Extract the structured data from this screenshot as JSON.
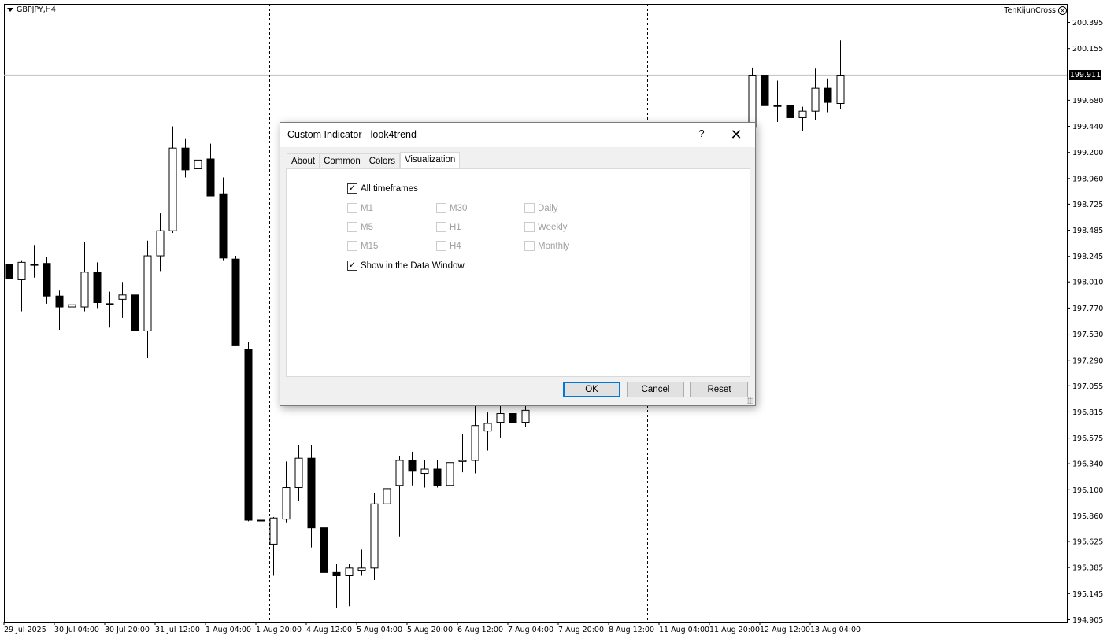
{
  "chart": {
    "symbol": "GBPJPY,H4",
    "indicator": "TenKijunCross",
    "current_price": "199.911",
    "price_levels": [
      "200.395",
      "200.155",
      "199.680",
      "199.440",
      "199.200",
      "198.960",
      "198.725",
      "198.485",
      "198.245",
      "198.010",
      "197.770",
      "197.530",
      "197.290",
      "197.055",
      "196.815",
      "196.575",
      "196.340",
      "196.100",
      "195.860",
      "195.625",
      "195.385",
      "195.145",
      "194.905"
    ],
    "time_labels": [
      "29 Jul 2025",
      "30 Jul 04:00",
      "30 Jul 20:00",
      "31 Jul 12:00",
      "1 Aug 04:00",
      "1 Aug 20:00",
      "4 Aug 12:00",
      "5 Aug 04:00",
      "5 Aug 20:00",
      "6 Aug 12:00",
      "7 Aug 04:00",
      "7 Aug 20:00",
      "8 Aug 12:00",
      "11 Aug 04:00",
      "11 Aug 20:00",
      "12 Aug 12:00",
      "13 Aug 04:00"
    ],
    "colors": {
      "bull_fill": "#ffffff",
      "bear_fill": "#000000",
      "grid": "#000000",
      "bid_line": "#c0c0c0"
    }
  },
  "chart_data": {
    "type": "candlestick",
    "xlabel": "",
    "ylabel": "",
    "ylim": [
      194.905,
      200.395
    ],
    "candles": [
      {
        "o": 198.17,
        "h": 198.29,
        "l": 198.0,
        "c": 198.04
      },
      {
        "o": 198.03,
        "h": 198.21,
        "l": 197.74,
        "c": 198.19
      },
      {
        "o": 198.17,
        "h": 198.35,
        "l": 198.05,
        "c": 198.17
      },
      {
        "o": 198.18,
        "h": 198.24,
        "l": 197.81,
        "c": 197.88
      },
      {
        "o": 197.88,
        "h": 197.93,
        "l": 197.57,
        "c": 197.78
      },
      {
        "o": 197.78,
        "h": 197.82,
        "l": 197.48,
        "c": 197.8
      },
      {
        "o": 197.78,
        "h": 198.38,
        "l": 197.74,
        "c": 198.1
      },
      {
        "o": 198.1,
        "h": 198.19,
        "l": 197.77,
        "c": 197.82
      },
      {
        "o": 197.81,
        "h": 197.92,
        "l": 197.59,
        "c": 197.81
      },
      {
        "o": 197.85,
        "h": 198.01,
        "l": 197.68,
        "c": 197.89
      },
      {
        "o": 197.89,
        "h": 197.9,
        "l": 197.0,
        "c": 197.56
      },
      {
        "o": 197.56,
        "h": 198.39,
        "l": 197.31,
        "c": 198.25
      },
      {
        "o": 198.25,
        "h": 198.64,
        "l": 198.11,
        "c": 198.48
      },
      {
        "o": 198.48,
        "h": 199.44,
        "l": 198.46,
        "c": 199.24
      },
      {
        "o": 199.24,
        "h": 199.33,
        "l": 198.97,
        "c": 199.04
      },
      {
        "o": 199.05,
        "h": 199.14,
        "l": 198.99,
        "c": 199.13
      },
      {
        "o": 199.14,
        "h": 199.28,
        "l": 198.86,
        "c": 198.8
      },
      {
        "o": 198.82,
        "h": 198.97,
        "l": 198.21,
        "c": 198.23
      },
      {
        "o": 198.22,
        "h": 198.25,
        "l": 197.43,
        "c": 197.43
      },
      {
        "o": 197.39,
        "h": 197.46,
        "l": 195.81,
        "c": 195.82
      },
      {
        "o": 195.82,
        "h": 195.84,
        "l": 195.35,
        "c": 195.82
      },
      {
        "o": 195.6,
        "h": 195.85,
        "l": 195.31,
        "c": 195.84
      },
      {
        "o": 195.83,
        "h": 196.36,
        "l": 195.8,
        "c": 196.12
      },
      {
        "o": 196.12,
        "h": 196.51,
        "l": 196.0,
        "c": 196.39
      },
      {
        "o": 196.39,
        "h": 196.51,
        "l": 195.57,
        "c": 195.75
      },
      {
        "o": 195.75,
        "h": 196.11,
        "l": 195.33,
        "c": 195.34
      },
      {
        "o": 195.34,
        "h": 195.42,
        "l": 195.01,
        "c": 195.31
      },
      {
        "o": 195.31,
        "h": 195.42,
        "l": 195.03,
        "c": 195.38
      },
      {
        "o": 195.36,
        "h": 195.55,
        "l": 195.31,
        "c": 195.38
      },
      {
        "o": 195.38,
        "h": 196.07,
        "l": 195.27,
        "c": 195.97
      },
      {
        "o": 195.97,
        "h": 196.4,
        "l": 195.9,
        "c": 196.11
      },
      {
        "o": 196.14,
        "h": 196.41,
        "l": 195.67,
        "c": 196.37
      },
      {
        "o": 196.37,
        "h": 196.45,
        "l": 196.14,
        "c": 196.27
      },
      {
        "o": 196.25,
        "h": 196.37,
        "l": 196.12,
        "c": 196.29
      },
      {
        "o": 196.29,
        "h": 196.37,
        "l": 196.12,
        "c": 196.14
      },
      {
        "o": 196.14,
        "h": 196.37,
        "l": 196.12,
        "c": 196.35
      },
      {
        "o": 196.36,
        "h": 196.61,
        "l": 196.26,
        "c": 196.37
      },
      {
        "o": 196.37,
        "h": 196.88,
        "l": 196.25,
        "c": 196.69
      },
      {
        "o": 196.64,
        "h": 196.81,
        "l": 196.46,
        "c": 196.71
      },
      {
        "o": 196.72,
        "h": 196.97,
        "l": 196.58,
        "c": 196.8
      },
      {
        "o": 196.8,
        "h": 196.84,
        "l": 196.0,
        "c": 196.72
      },
      {
        "o": 196.72,
        "h": 196.95,
        "l": 196.68,
        "c": 196.83
      },
      {
        "o": 199.43,
        "h": 199.98,
        "l": 199.38,
        "c": 199.91
      },
      {
        "o": 199.91,
        "h": 199.95,
        "l": 199.6,
        "c": 199.63
      },
      {
        "o": 199.63,
        "h": 199.86,
        "l": 199.48,
        "c": 199.63
      },
      {
        "o": 199.63,
        "h": 199.67,
        "l": 199.3,
        "c": 199.52
      },
      {
        "o": 199.52,
        "h": 199.62,
        "l": 199.4,
        "c": 199.58
      },
      {
        "o": 199.58,
        "h": 199.97,
        "l": 199.5,
        "c": 199.79
      },
      {
        "o": 199.79,
        "h": 199.88,
        "l": 199.57,
        "c": 199.66
      },
      {
        "o": 199.65,
        "h": 200.23,
        "l": 199.6,
        "c": 199.91
      }
    ]
  },
  "dialog": {
    "title": "Custom Indicator - look4trend",
    "help": "?",
    "close": "✕",
    "tabs": [
      "About",
      "Common",
      "Colors",
      "Visualization"
    ],
    "active_tab": "Visualization",
    "all_timeframes": {
      "label": "All timeframes",
      "checked": "✓"
    },
    "timeframes": [
      {
        "label": "M1"
      },
      {
        "label": "M30"
      },
      {
        "label": "Daily"
      },
      {
        "label": "M5"
      },
      {
        "label": "H1"
      },
      {
        "label": "Weekly"
      },
      {
        "label": "M15"
      },
      {
        "label": "H4"
      },
      {
        "label": "Monthly"
      }
    ],
    "show_data_window": {
      "label": "Show in the Data Window",
      "checked": "✓"
    },
    "buttons": {
      "ok": "OK",
      "cancel": "Cancel",
      "reset": "Reset"
    }
  }
}
